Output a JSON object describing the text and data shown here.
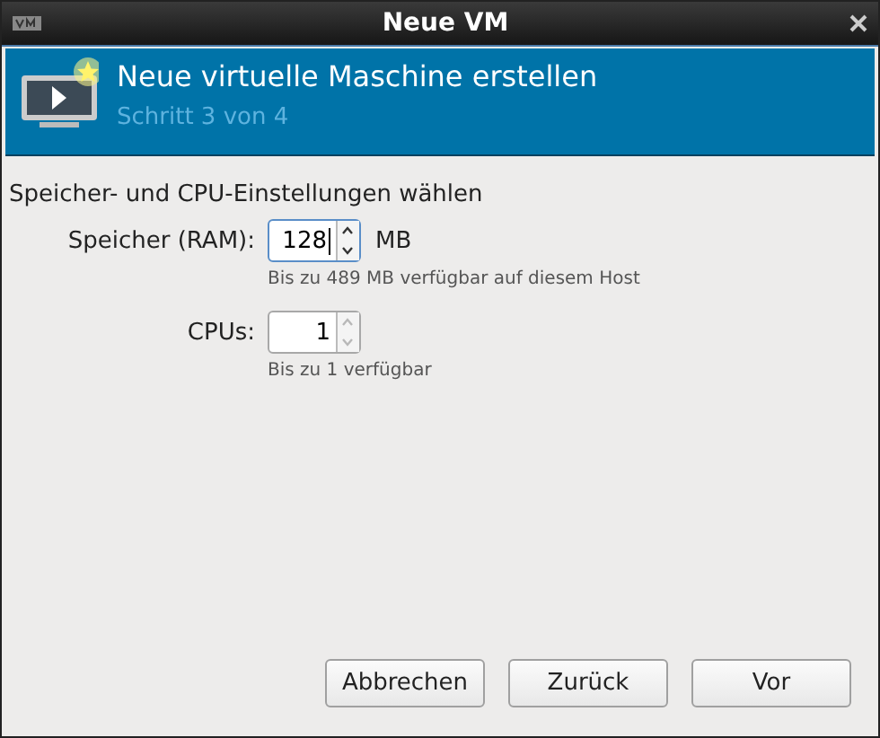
{
  "window": {
    "title": "Neue VM"
  },
  "banner": {
    "title": "Neue virtuelle Maschine erstellen",
    "step": "Schritt 3 von 4"
  },
  "section_title": "Speicher- und CPU-Einstellungen wählen",
  "fields": [
    {
      "label": "Speicher (RAM):",
      "value": "128",
      "unit": "MB",
      "focused": true,
      "up_disabled": false,
      "down_disabled": false,
      "hint": "Bis zu 489 MB verfügbar auf diesem Host"
    },
    {
      "label": "CPUs:",
      "value": "1",
      "focused": false,
      "up_disabled": true,
      "down_disabled": true,
      "hint": "Bis zu 1 verfügbar"
    }
  ],
  "buttons": [
    "Abbrechen",
    "Zurück",
    "Vor"
  ]
}
